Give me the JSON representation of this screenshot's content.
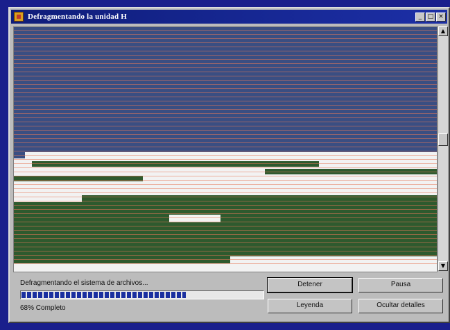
{
  "window": {
    "title": "Defragmentando la unidad H",
    "controls": {
      "minimize": "_",
      "maximize": "□",
      "close": "×"
    }
  },
  "scrollbar": {
    "up": "▲",
    "down": "▼"
  },
  "status": {
    "message": "Defragmentando el sistema de archivos...",
    "percent_label": "68% Completo",
    "progress_value": 0.68
  },
  "buttons": {
    "stop": "Detener",
    "pause": "Pausa",
    "legend": "Leyenda",
    "hide_details": "Ocultar detalles"
  },
  "colors": {
    "used_block": "#3a4e82",
    "fragmented_block": "#2e5a2e",
    "free_space": "#f2f2f2",
    "title_bar": "#0f1d7a",
    "progress": "#1a2fa0"
  }
}
